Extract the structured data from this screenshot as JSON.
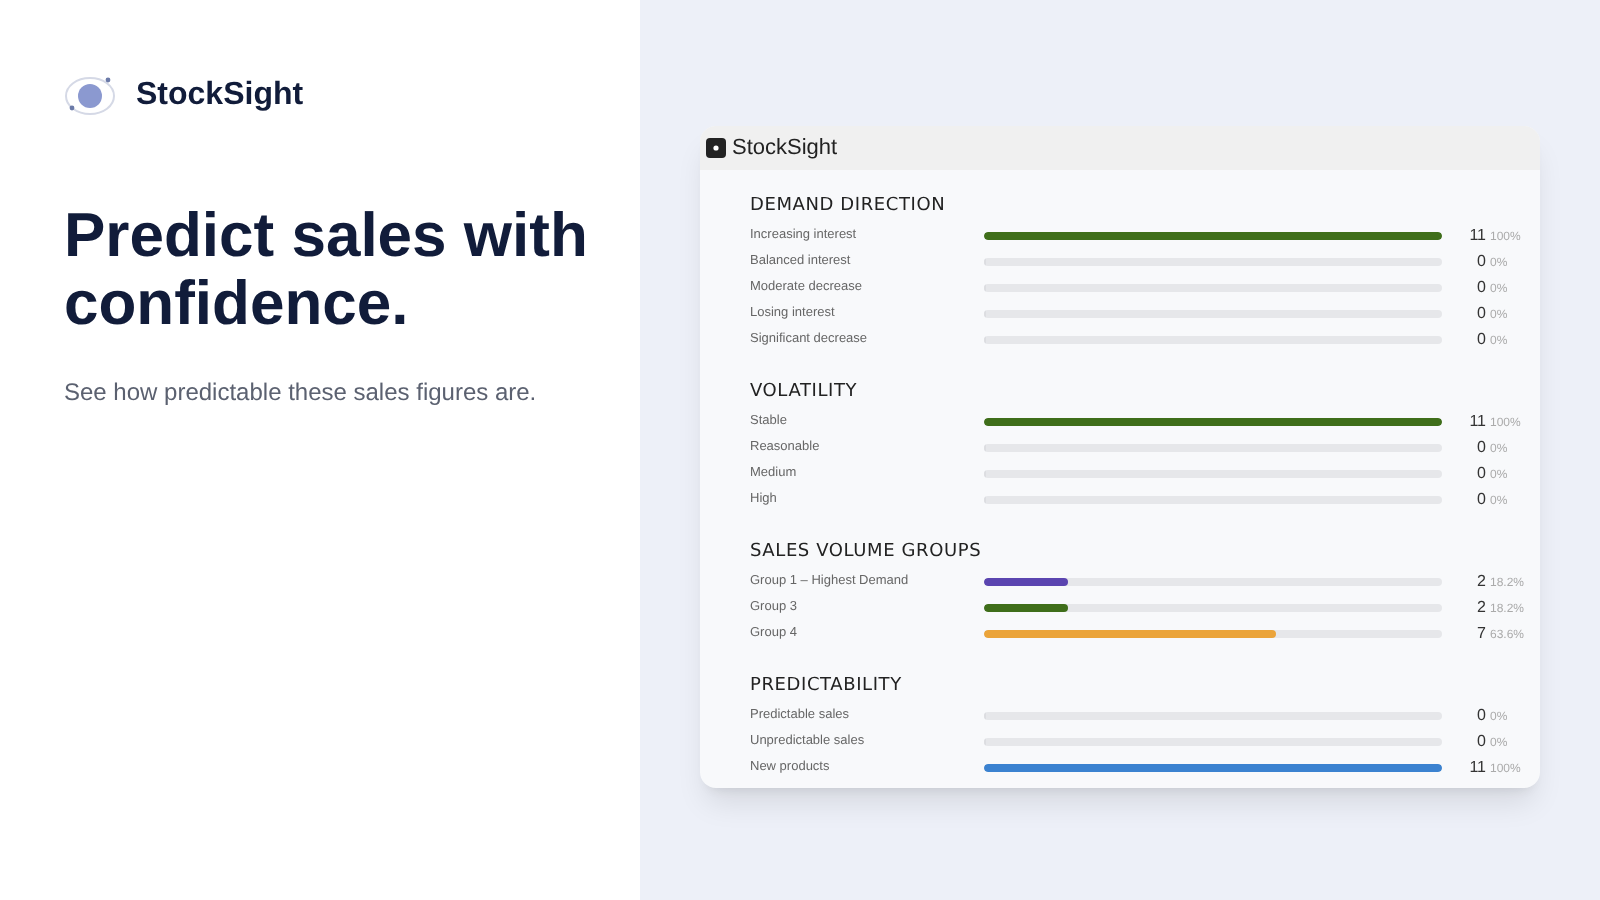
{
  "brand": {
    "name": "StockSight"
  },
  "headline": "Predict sales with confidence.",
  "subtitle": "See how predictable these sales figures are.",
  "app": {
    "title": "StockSight",
    "sections": [
      {
        "title": "DEMAND DIRECTION",
        "rows": [
          {
            "label": "Increasing interest",
            "level": 1,
            "color": "#3f6e1a",
            "count": "11",
            "percent": "100%"
          },
          {
            "label": "Balanced interest",
            "level": 0,
            "count": "0",
            "percent": "0%"
          },
          {
            "label": "Moderate decrease",
            "level": 0,
            "count": "0",
            "percent": "0%"
          },
          {
            "label": "Losing interest",
            "level": 0,
            "count": "0",
            "percent": "0%"
          },
          {
            "label": "Significant decrease",
            "level": 0,
            "count": "0",
            "percent": "0%"
          }
        ]
      },
      {
        "title": "VOLATILITY",
        "rows": [
          {
            "label": "Stable",
            "level": 1,
            "color": "#3f6e1a",
            "count": "11",
            "percent": "100%"
          },
          {
            "label": "Reasonable",
            "level": 0,
            "count": "0",
            "percent": "0%"
          },
          {
            "label": "Medium",
            "level": 0,
            "count": "0",
            "percent": "0%"
          },
          {
            "label": "High",
            "level": 0,
            "count": "0",
            "percent": "0%"
          }
        ]
      },
      {
        "title": "SALES VOLUME GROUPS",
        "rows": [
          {
            "label": "Group 1 – Highest Demand",
            "level": 0.182,
            "color": "#5b45b0",
            "count": "2",
            "percent": "18.2%"
          },
          {
            "label": "Group 3",
            "level": 0.182,
            "color": "#3f6e1a",
            "count": "2",
            "percent": "18.2%"
          },
          {
            "label": "Group 4",
            "level": 0.636,
            "color": "#eba43a",
            "count": "7",
            "percent": "63.6%"
          }
        ]
      },
      {
        "title": "PREDICTABILITY",
        "rows": [
          {
            "label": "Predictable sales",
            "level": 0,
            "count": "0",
            "percent": "0%"
          },
          {
            "label": "Unpredictable sales",
            "level": 0,
            "count": "0",
            "percent": "0%"
          },
          {
            "label": "New products",
            "level": 1,
            "color": "#3b82d0",
            "count": "11",
            "percent": "100%"
          }
        ]
      }
    ]
  }
}
